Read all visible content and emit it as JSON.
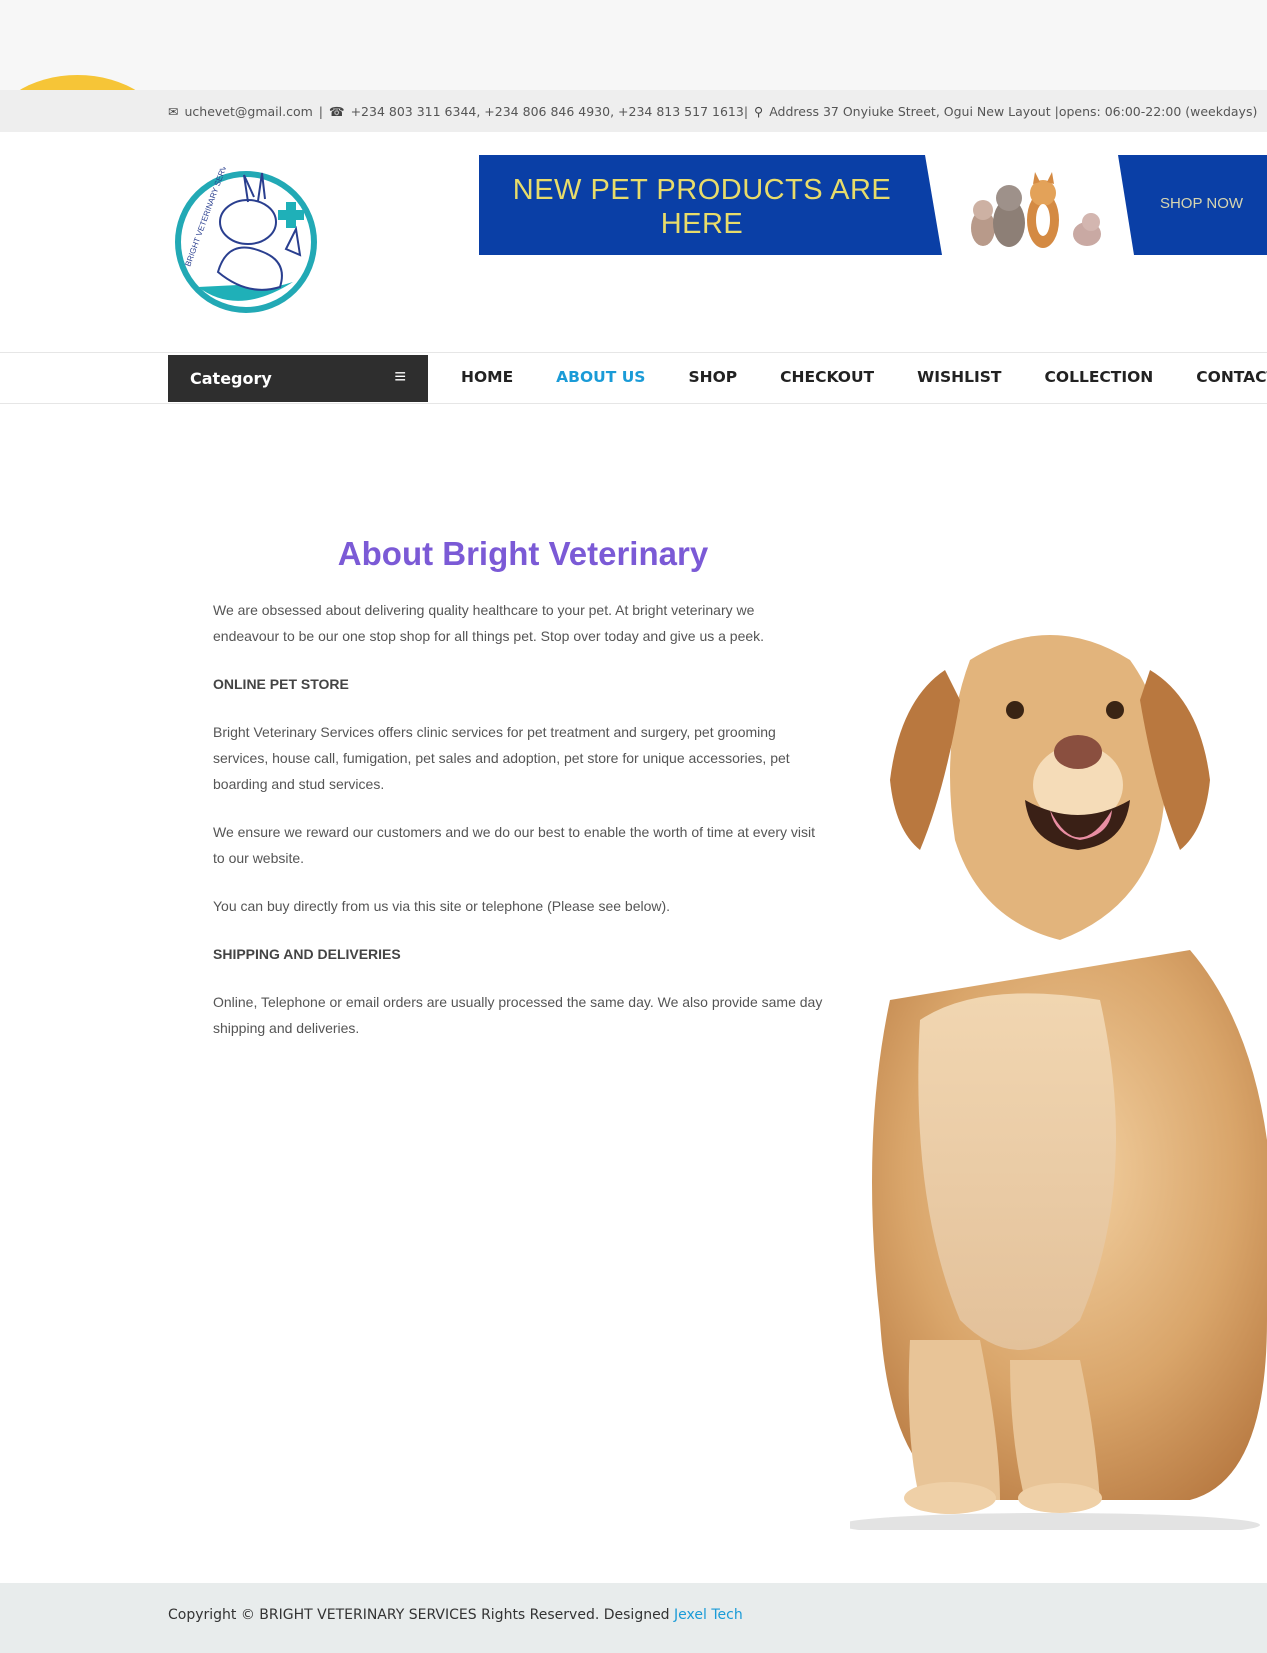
{
  "topbar": {
    "email": "uchevet@gmail.com",
    "phones": "+234 803 311 6344, +234 806 846 4930, +234 813 517 1613|",
    "address": "Address 37 Onyiuke Street, Ogui New Layout |opens: 06:00-22:00 (weekdays)"
  },
  "logo": {
    "text": "BRIGHT VETERINARY SERVICES"
  },
  "banner": {
    "headline_line1": "NEW PET PRODUCTS ARE",
    "headline_line2": "HERE",
    "cta": "SHOP NOW"
  },
  "nav": {
    "category_label": "Category",
    "items": [
      {
        "label": "HOME"
      },
      {
        "label": "ABOUT US",
        "active": true
      },
      {
        "label": "SHOP"
      },
      {
        "label": "CHECKOUT"
      },
      {
        "label": "WISHLIST"
      },
      {
        "label": "COLLECTION"
      },
      {
        "label": "CONTACT"
      }
    ]
  },
  "about": {
    "title": "About Bright Veterinary",
    "intro": "We are obsessed about delivering quality healthcare to your pet. At bright veterinary we endeavour to be our one stop shop for all things pet. Stop over today and give us a peek.",
    "section1_heading": "ONLINE PET STORE",
    "section1_text": "Bright Veterinary Services offers clinic services for pet treatment and surgery, pet grooming services, house call, fumigation, pet sales and adoption, pet store for unique accessories, pet boarding and stud services.",
    "reward_text": "We ensure we reward our customers and we do our best to enable the worth of time at every visit to our website.",
    "buy_text": "You can buy directly from us via this site or telephone (Please see below).",
    "section2_heading": "SHIPPING AND DELIVERIES",
    "section2_text": "Online, Telephone or email orders are usually processed the same day. We also provide same day shipping and deliveries."
  },
  "footer": {
    "copyright": "Copyright © BRIGHT VETERINARY SERVICES Rights Reserved. Designed ",
    "designer": "Jexel Tech"
  },
  "colors": {
    "banner_blue": "#0a3fa6",
    "title_purple": "#7b5ad6",
    "active_blue": "#1a9bd7",
    "category_bg": "#2e2e2e",
    "accent_yellow": "#f6c537"
  }
}
